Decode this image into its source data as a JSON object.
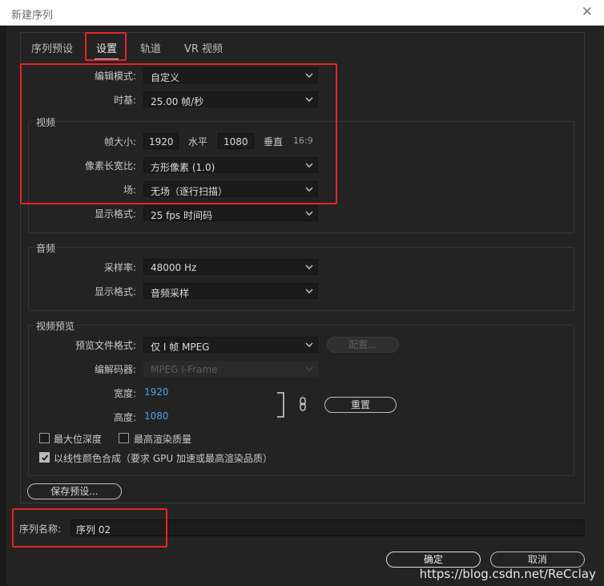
{
  "window": {
    "title": "新建序列",
    "close_glyph": "✕"
  },
  "tabs": [
    {
      "label": "序列预设"
    },
    {
      "label": "设置"
    },
    {
      "label": "轨道"
    },
    {
      "label": "VR 视频"
    }
  ],
  "settings": {
    "edit_mode": {
      "label": "编辑模式:",
      "value": "自定义"
    },
    "timebase": {
      "label": "时基:",
      "value": "25.00  帧/秒"
    }
  },
  "video": {
    "section": "视频",
    "frame_size": {
      "label": "帧大小:",
      "width": "1920",
      "width_unit": "水平",
      "height": "1080",
      "height_unit": "垂直",
      "aspect": "16:9"
    },
    "pixel_aspect": {
      "label": "像素长宽比:",
      "value": "方形像素 (1.0)"
    },
    "fields": {
      "label": "场:",
      "value": "无场（逐行扫描）"
    },
    "display_format": {
      "label": "显示格式:",
      "value": "25 fps 时间码"
    }
  },
  "audio": {
    "section": "音频",
    "sample_rate": {
      "label": "采样率:",
      "value": "48000 Hz"
    },
    "display_format": {
      "label": "显示格式:",
      "value": "音频采样"
    }
  },
  "preview": {
    "section": "视频预览",
    "file_format": {
      "label": "预览文件格式:",
      "value": "仅 I 帧 MPEG"
    },
    "configure": "配置...",
    "codec": {
      "label": "编解码器:",
      "value": "MPEG I-Frame"
    },
    "width": {
      "label": "宽度:",
      "value": "1920"
    },
    "height": {
      "label": "高度:",
      "value": "1080"
    },
    "reset": "重置",
    "max_bit_depth": "最大位深度",
    "max_render_quality": "最高渲染质量",
    "linear_color": "以线性颜色合成（要求 GPU 加速或最高渲染品质）",
    "checkbox_states": {
      "max_bit_depth": false,
      "max_render_quality": false,
      "linear_color": true
    }
  },
  "save_preset": "保存预设...",
  "sequence_name": {
    "label": "序列名称:",
    "value": "序列 02"
  },
  "footer": {
    "ok": "确定",
    "cancel": "取消"
  },
  "watermark": "https://blog.csdn.net/ReCclay",
  "colors": {
    "highlight": "#e8212a",
    "link": "#4aa0e6",
    "background": "#232323"
  }
}
